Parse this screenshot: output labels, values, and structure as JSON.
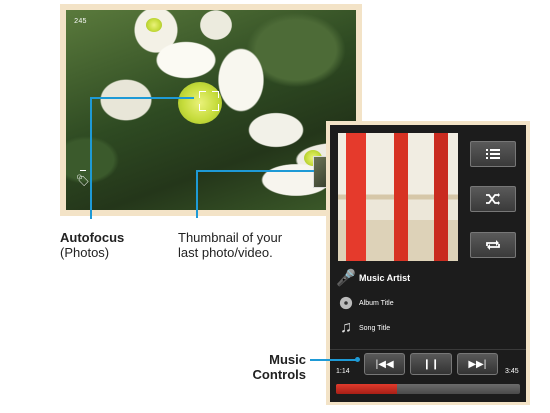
{
  "camera": {
    "shot_counter": "245"
  },
  "music": {
    "artist": "Music Artist",
    "album": "Album Title",
    "song": "Song Title",
    "elapsed": "1:14",
    "duration": "3:45",
    "progress_fraction": 0.33,
    "controls": {
      "prev_glyph": "|◀◀",
      "pause_glyph": "❙❙",
      "next_glyph": "▶▶|"
    },
    "side_buttons": [
      "list-icon",
      "shuffle-icon",
      "repeat-icon"
    ],
    "accent": "#e03a2c"
  },
  "callouts": {
    "autofocus_title": "Autofocus",
    "autofocus_sub": "(Photos)",
    "thumbnail_line1": "Thumbnail of your",
    "thumbnail_line2": "last photo/video.",
    "music_controls_line1": "Music",
    "music_controls_line2": "Controls",
    "line_color": "#1e9ad6"
  }
}
